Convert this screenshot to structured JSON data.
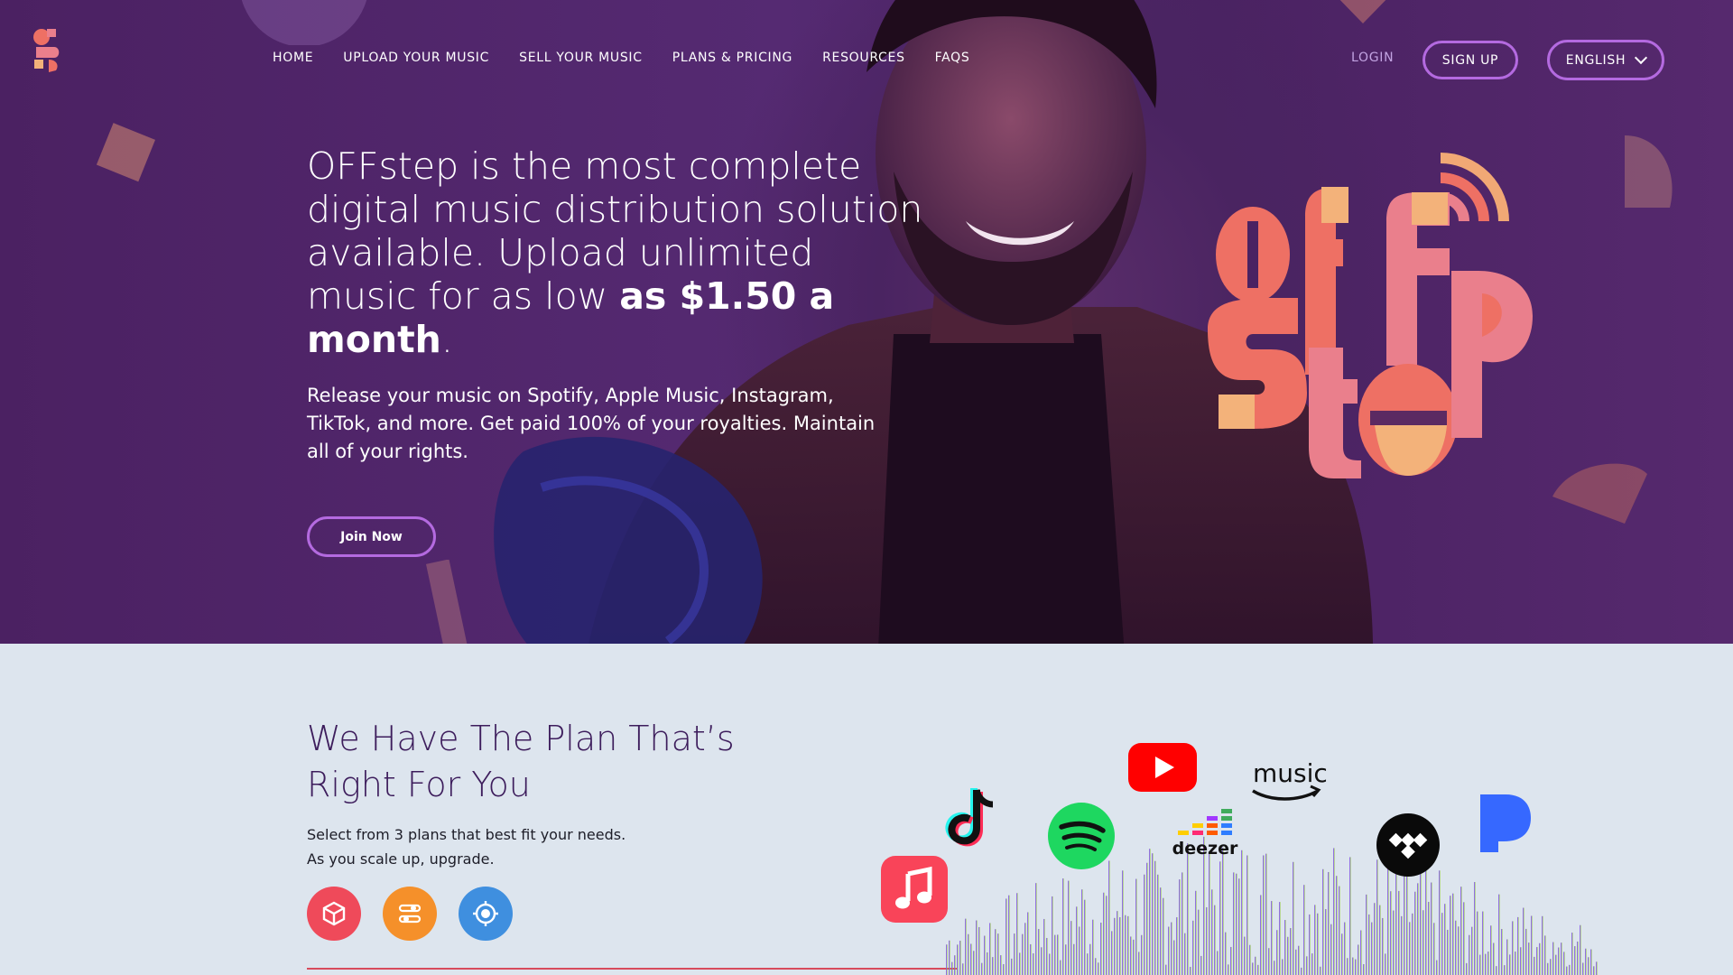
{
  "nav": {
    "items": [
      "HOME",
      "UPLOAD YOUR MUSIC",
      "SELL YOUR MUSIC",
      "PLANS & PRICING",
      "RESOURCES",
      "FAQS"
    ],
    "login": "LOGIN",
    "signup": "SIGN UP",
    "language": "ENGLISH"
  },
  "hero": {
    "headline_regular": "OFFstep is the most complete digital music distribution solution available. Upload unlimited music for as low ",
    "headline_bold": "as $1.50 a month",
    "headline_end": ".",
    "subtext": "Release your music on Spotify, Apple Music, Instagram, TikTok, and more. Get paid 100% of your royalties. Maintain all of your rights.",
    "cta": "Join Now"
  },
  "plans": {
    "title": "We Have The Plan That’s Right For You",
    "line1": "Select from 3 plans that best fit your needs.",
    "line2": "As you scale up, upgrade.",
    "icons": [
      {
        "name": "cube-icon",
        "color": "#ef4a5a"
      },
      {
        "name": "sliders-icon",
        "color": "#f5902a"
      },
      {
        "name": "target-icon",
        "color": "#3f8fdf"
      }
    ]
  },
  "platforms": {
    "amazon_label": "music",
    "deezer_label": "deezer",
    "icons": [
      "apple-music-icon",
      "tiktok-icon",
      "spotify-icon",
      "youtube-icon",
      "deezer-icon",
      "amazon-music-icon",
      "tidal-icon",
      "pandora-icon"
    ]
  },
  "colors": {
    "hero_purple": "#4b2162",
    "accent_border": "#b46ae0",
    "brand_coral": "#ee7064",
    "brand_pink": "#ea7f8c",
    "brand_peach": "#f3b27a",
    "section_bg": "#dde5ee",
    "title_purple": "#3d1d5c"
  }
}
